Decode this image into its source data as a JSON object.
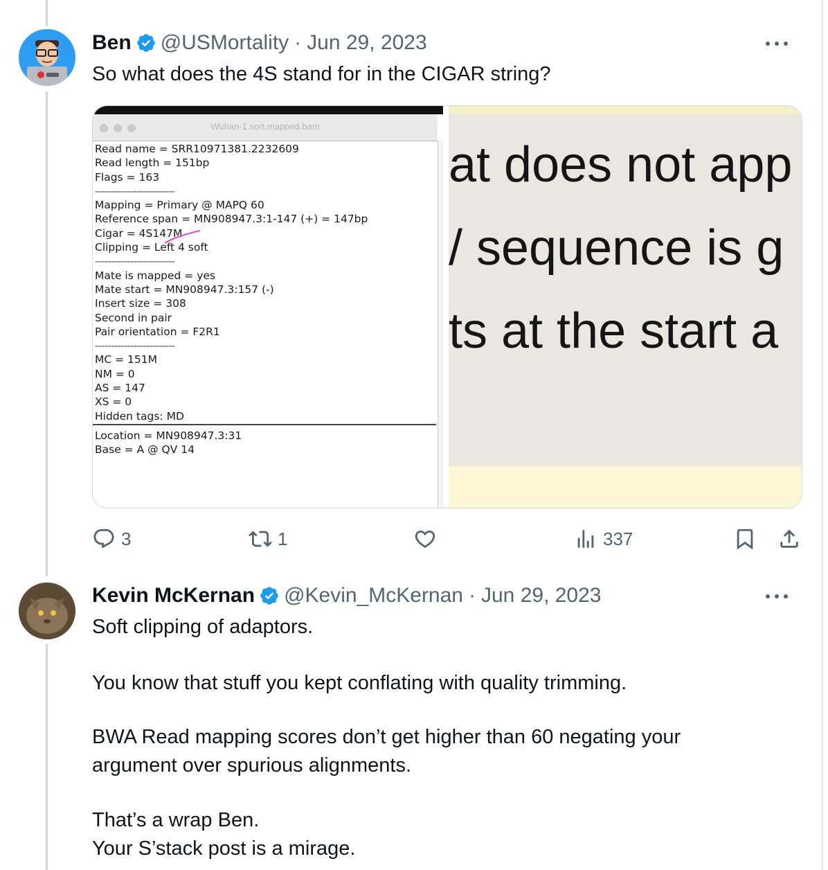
{
  "tweet1": {
    "author_name": "Ben",
    "handle": "@USMortality",
    "date": "Jun 29, 2023",
    "separator": "·",
    "text": "So what does the 4S stand for in the CIGAR string?",
    "media": {
      "window_title": "Wuhan-1.sort.mapped.bam",
      "bam_lines": [
        "Read name = SRR10971381.2232609",
        "Read length = 151bp",
        "Flags = 163",
        "-------------------------",
        "Mapping = Primary @ MAPQ 60",
        "Reference span = MN908947.3:1-147 (+) = 147bp",
        "Cigar = 4S147M",
        "Clipping = Left 4 soft",
        "-------------------------",
        "Mate is mapped = yes",
        "Mate start = MN908947.3:157 (-)",
        "Insert size = 308",
        "Second in pair",
        "Pair orientation = F2R1",
        "-------------------------",
        "MC = 151M",
        "NM = 0",
        "AS = 147",
        "XS = 0",
        "Hidden tags: MD"
      ],
      "bam_lower_lines": [
        "Location = MN908947.3:31",
        "Base = A @ QV 14"
      ],
      "zoom_lines": [
        "at does not app",
        "/ sequence is g",
        "ts at the start a"
      ]
    },
    "actions": {
      "reply_count": "3",
      "retweet_count": "1",
      "views_count": "337"
    }
  },
  "tweet2": {
    "author_name": "Kevin McKernan",
    "handle": "@Kevin_McKernan",
    "date": "Jun 29, 2023",
    "separator": "·",
    "paragraphs": [
      "Soft clipping of adaptors.",
      "You know that stuff you kept conflating with quality trimming.",
      "BWA Read mapping scores don’t get higher than 60 negating your argument over spurious alignments.",
      "That’s a wrap Ben.\nYour S’stack post is a mirage."
    ]
  },
  "colors": {
    "verified": "#1d9bf0",
    "muted": "#536471",
    "thread_line": "#cfd9de"
  }
}
